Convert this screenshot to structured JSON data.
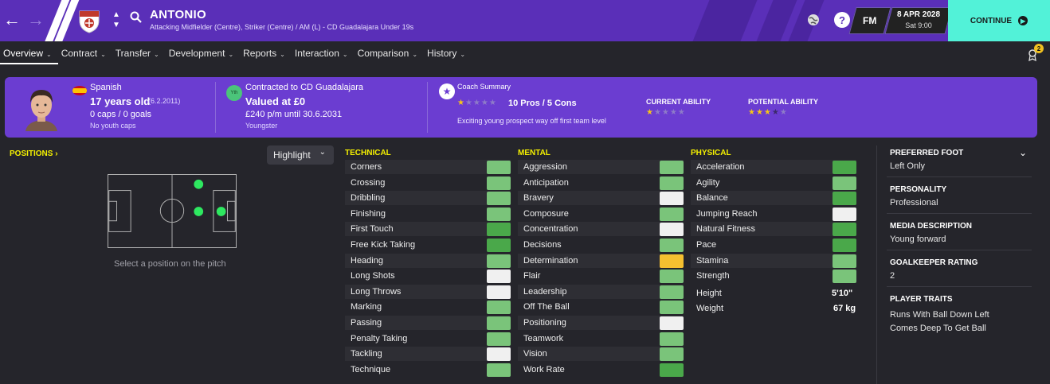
{
  "topbar": {
    "player_name": "ANTONIO",
    "player_subtitle": "Attacking Midfielder (Centre), Striker (Centre) / AM (L) - CD Guadalajara Under 19s",
    "fm_label": "FM",
    "date": "8 APR 2028",
    "day_time": "Sat 9:00",
    "continue_label": "CONTINUE"
  },
  "tabs": [
    {
      "label": "Overview"
    },
    {
      "label": "Contract"
    },
    {
      "label": "Transfer"
    },
    {
      "label": "Development"
    },
    {
      "label": "Reports"
    },
    {
      "label": "Interaction"
    },
    {
      "label": "Comparison"
    },
    {
      "label": "History"
    }
  ],
  "notifications": {
    "count": "2"
  },
  "info": {
    "nationality": "Spanish",
    "age": "17 years old",
    "dob": "(6.2.2011)",
    "caps": "0 caps / 0 goals",
    "youth_caps": "No youth caps",
    "yth_badge": "Yth",
    "contract": "Contracted to CD Guadalajara",
    "value": "Valued at £0",
    "wage": "£240 p/m until 30.6.2031",
    "status": "Youngster",
    "coach_title": "Coach Summary",
    "pros_cons": "10 Pros / 5 Cons",
    "coach_text": "Exciting young prospect way off first team level",
    "ca_label": "CURRENT ABILITY",
    "pa_label": "POTENTIAL ABILITY",
    "coach_stars": 0.5,
    "ca_stars": 0.5,
    "pa_stars": 3.5
  },
  "positions": {
    "title": "POSITIONS",
    "highlight": "Highlight",
    "hint": "Select a position on the pitch"
  },
  "technical": {
    "title": "TECHNICAL",
    "rows": [
      {
        "name": "Corners",
        "color": "green"
      },
      {
        "name": "Crossing",
        "color": "green"
      },
      {
        "name": "Dribbling",
        "color": "green"
      },
      {
        "name": "Finishing",
        "color": "green"
      },
      {
        "name": "First Touch",
        "color": "dgreen"
      },
      {
        "name": "Free Kick Taking",
        "color": "dgreen"
      },
      {
        "name": "Heading",
        "color": "green"
      },
      {
        "name": "Long Shots",
        "color": "white"
      },
      {
        "name": "Long Throws",
        "color": "white"
      },
      {
        "name": "Marking",
        "color": "green"
      },
      {
        "name": "Passing",
        "color": "green"
      },
      {
        "name": "Penalty Taking",
        "color": "green"
      },
      {
        "name": "Tackling",
        "color": "white"
      },
      {
        "name": "Technique",
        "color": "green"
      }
    ]
  },
  "mental": {
    "title": "MENTAL",
    "rows": [
      {
        "name": "Aggression",
        "color": "green"
      },
      {
        "name": "Anticipation",
        "color": "green"
      },
      {
        "name": "Bravery",
        "color": "white"
      },
      {
        "name": "Composure",
        "color": "green"
      },
      {
        "name": "Concentration",
        "color": "white"
      },
      {
        "name": "Decisions",
        "color": "green"
      },
      {
        "name": "Determination",
        "color": "gold"
      },
      {
        "name": "Flair",
        "color": "green"
      },
      {
        "name": "Leadership",
        "color": "green"
      },
      {
        "name": "Off The Ball",
        "color": "green"
      },
      {
        "name": "Positioning",
        "color": "white"
      },
      {
        "name": "Teamwork",
        "color": "green"
      },
      {
        "name": "Vision",
        "color": "green"
      },
      {
        "name": "Work Rate",
        "color": "dgreen"
      }
    ]
  },
  "physical": {
    "title": "PHYSICAL",
    "rows": [
      {
        "name": "Acceleration",
        "color": "dgreen"
      },
      {
        "name": "Agility",
        "color": "green"
      },
      {
        "name": "Balance",
        "color": "dgreen"
      },
      {
        "name": "Jumping Reach",
        "color": "white"
      },
      {
        "name": "Natural Fitness",
        "color": "dgreen"
      },
      {
        "name": "Pace",
        "color": "dgreen"
      },
      {
        "name": "Stamina",
        "color": "green"
      },
      {
        "name": "Strength",
        "color": "green"
      }
    ],
    "height_label": "Height",
    "height_value": "5'10\"",
    "weight_label": "Weight",
    "weight_value": "67 kg"
  },
  "side": {
    "foot_label": "PREFERRED FOOT",
    "foot_value": "Left Only",
    "personality_label": "PERSONALITY",
    "personality_value": "Professional",
    "media_label": "MEDIA DESCRIPTION",
    "media_value": "Young forward",
    "gk_label": "GOALKEEPER RATING",
    "gk_value": "2",
    "traits_label": "PLAYER TRAITS",
    "trait1": "Runs With Ball Down Left",
    "trait2": "Comes Deep To Get Ball"
  },
  "colors": {
    "topbar": "#5a2fb8",
    "panel": "#6b3dd1",
    "accent": "#52f2d8",
    "heading_yellow": "#f4f000"
  }
}
